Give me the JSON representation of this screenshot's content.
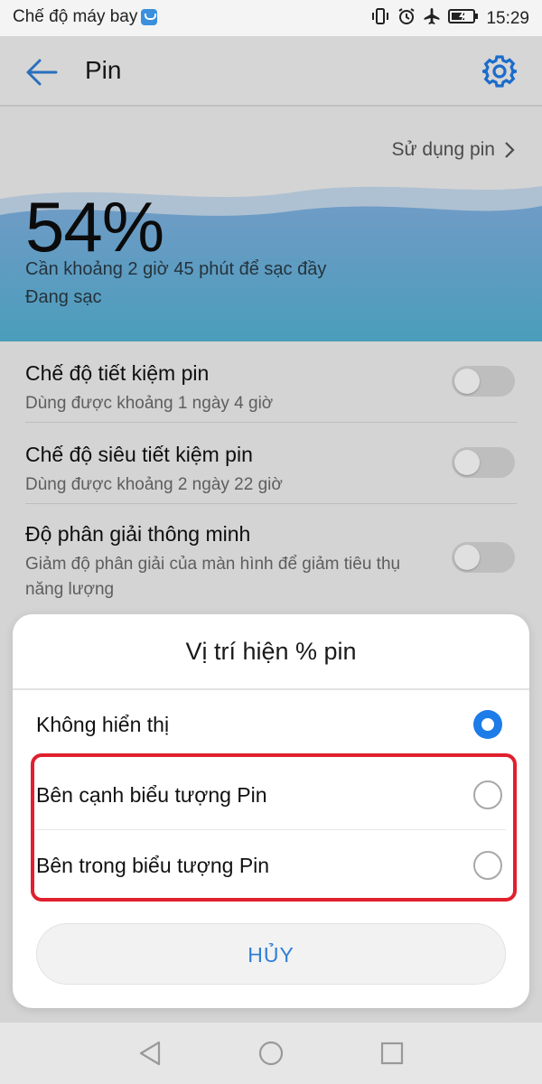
{
  "status_bar": {
    "label": "Chế độ máy bay",
    "time": "15:29",
    "icons": [
      "vibrate-icon",
      "alarm-icon",
      "airplane-icon",
      "battery-charging-icon"
    ]
  },
  "app_bar": {
    "title": "Pin",
    "back_icon": "arrow-left-icon",
    "settings_icon": "gear-icon"
  },
  "battery": {
    "usage_link": "Sử dụng pin",
    "percent": "54%",
    "estimate": "Cần khoảng 2 giờ 45 phút để sạc đầy",
    "state": "Đang sạc"
  },
  "settings": [
    {
      "title": "Chế độ tiết kiệm pin",
      "subtitle": "Dùng được khoảng 1 ngày 4 giờ",
      "enabled": false
    },
    {
      "title": "Chế độ siêu tiết kiệm pin",
      "subtitle": "Dùng được khoảng 2 ngày 22 giờ",
      "enabled": false
    },
    {
      "title": "Độ phân giải thông minh",
      "subtitle": "Giảm độ phân giải của màn hình để giảm tiêu thụ năng lượng",
      "enabled": false
    }
  ],
  "dialog": {
    "title": "Vị trí hiện % pin",
    "options": [
      {
        "label": "Không hiển thị",
        "selected": true
      },
      {
        "label": "Bên cạnh biểu tượng Pin",
        "selected": false
      },
      {
        "label": "Bên trong biểu tượng Pin",
        "selected": false
      }
    ],
    "cancel_label": "HỦY"
  },
  "colors": {
    "accent": "#1e7ce8",
    "highlight": "#e0202e",
    "wave_top": "#a9c9ea",
    "wave_bottom": "#55b3d6"
  },
  "nav_bar": {
    "icons": [
      "back-triangle-icon",
      "home-circle-icon",
      "recents-square-icon"
    ]
  }
}
